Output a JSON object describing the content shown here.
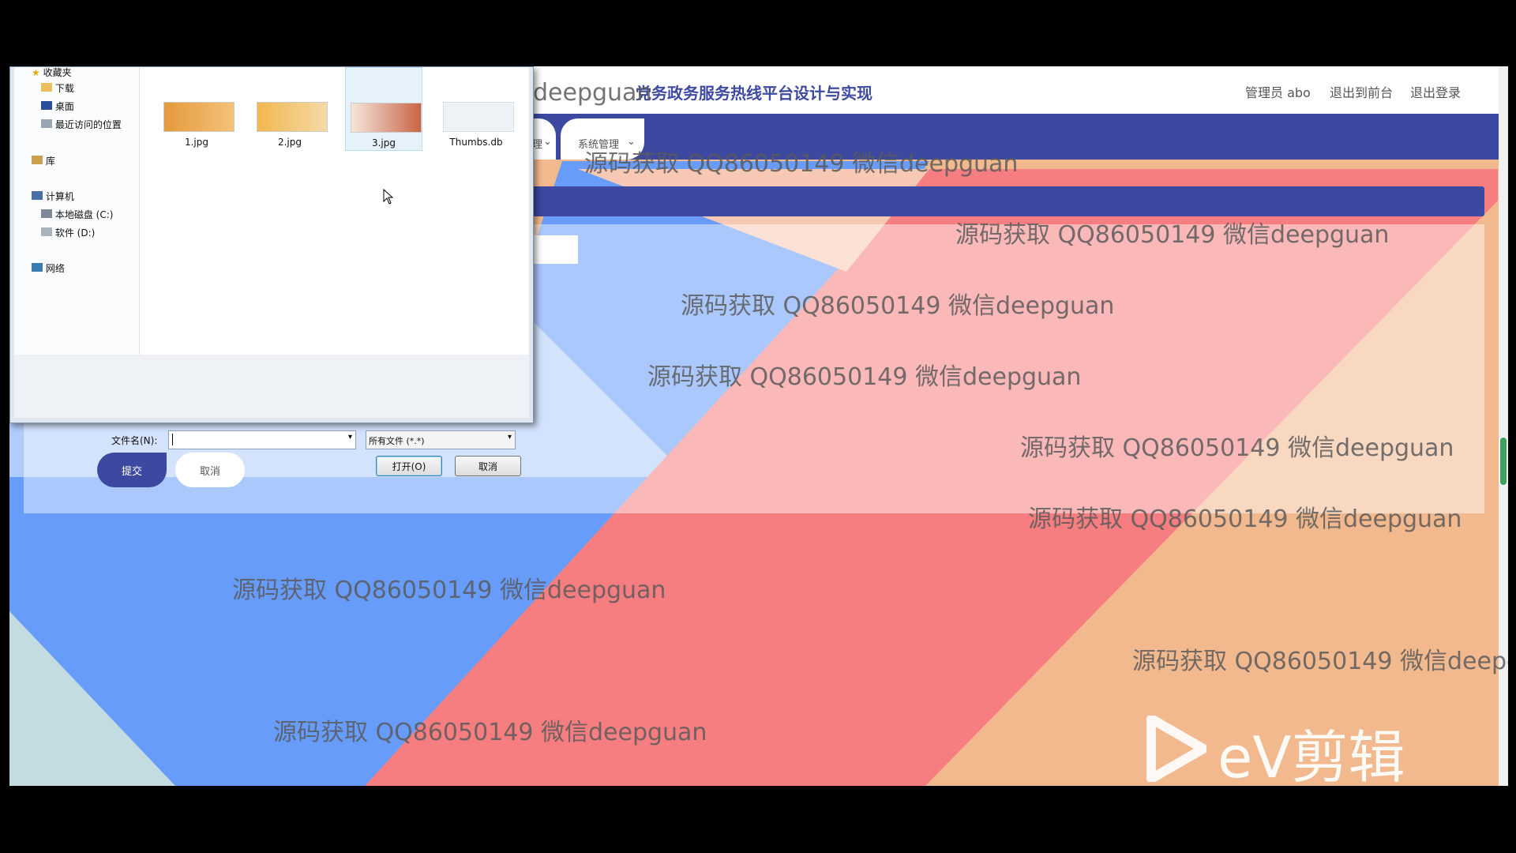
{
  "header": {
    "title": "党务政务服务热线平台设计与实现",
    "admin_label": "管理员 abo",
    "exit_front_label": "退出到前台",
    "logout_label": "退出登录"
  },
  "nav": {
    "tab_partial": "理",
    "tab_system": "系统管理"
  },
  "form": {
    "submit_label": "提交",
    "cancel_label": "取消"
  },
  "watermark": "源码获取 QQ86050149 微信deepguan",
  "watermark_clipped": "源码获取 QQ86050149 微信deepg",
  "ev_logo": {
    "text": "eV剪辑"
  },
  "file_dialog": {
    "nav_items": [
      "收藏夹",
      "下载",
      "桌面",
      "最近访问的位置",
      "库",
      "计算机",
      "本地磁盘 (C:)",
      "软件 (D:)",
      "网络"
    ],
    "files": [
      {
        "name": "1.jpg",
        "icon": "image-thumbnail"
      },
      {
        "name": "2.jpg",
        "icon": "image-thumbnail"
      },
      {
        "name": "3.jpg",
        "icon": "image-thumbnail"
      },
      {
        "name": "Thumbs.db",
        "icon": "gear-file-icon"
      }
    ],
    "filename_label": "文件名(N):",
    "filename_value": "",
    "filetype_value": "所有文件 (*.*)",
    "open_label": "打开(O)",
    "cancel_label": "取消"
  },
  "colors": {
    "primary": "#3d48a0",
    "bg_peach": "#f3b98e",
    "bg_pink": "#f67e80",
    "bg_blue": "#679cfb",
    "bg_lightblue": "#b0ccfb"
  }
}
